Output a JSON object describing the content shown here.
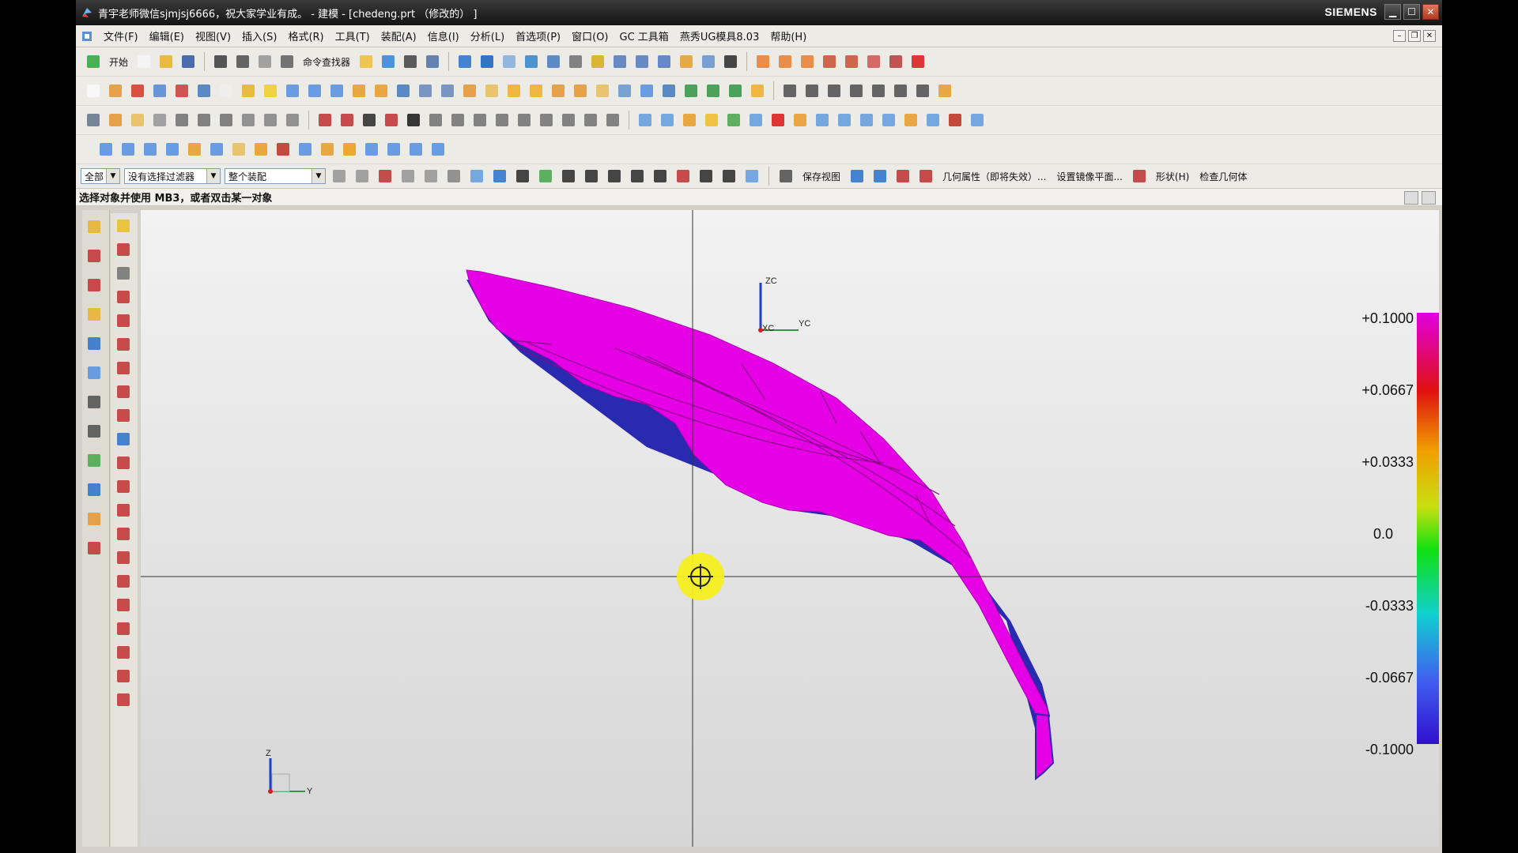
{
  "window": {
    "title": "青宇老师微信sjmjsj6666，祝大家学业有成。 - 建模 - [chedeng.prt （修改的） ]",
    "brand": "SIEMENS",
    "controls": {
      "minimize": "▁",
      "maximize": "☐",
      "close": "✕"
    }
  },
  "menubar": {
    "items": [
      "文件(F)",
      "编辑(E)",
      "视图(V)",
      "插入(S)",
      "格式(R)",
      "工具(T)",
      "装配(A)",
      "信息(I)",
      "分析(L)",
      "首选项(P)",
      "窗口(O)",
      "GC 工具箱",
      "燕秀UG模具8.03",
      "帮助(H)"
    ],
    "mdi_controls": {
      "minimize": "–",
      "restore": "❐",
      "close": "✕"
    }
  },
  "toolbar": {
    "start_label": "开始",
    "command_finder_label": "命令查找器"
  },
  "selection_bar": {
    "filter_scope": "全部",
    "type_filter": "没有选择过滤器",
    "assembly_scope": "整个装配",
    "save_view_label": "保存视图",
    "geom_props_label": "几何属性（即将失效）...",
    "mirror_plane_label": "设置镜像平面...",
    "shape_label": "形状(H)",
    "check_geom_label": "检查几何体"
  },
  "cue_line": {
    "text": "选择对象并使用 MB3，或者双击某一对象"
  },
  "viewport": {
    "wcs_labels": {
      "z": "ZC",
      "y": "YC",
      "x": "XC"
    },
    "abs_csys_labels": {
      "z": "Z",
      "y": "Y"
    },
    "legend": {
      "ticks": [
        "+0.1000",
        "+0.0667",
        "+0.0333",
        "0.0",
        "-0.0333",
        "-0.0667",
        "-0.1000"
      ]
    },
    "colors": {
      "part": "#e600e6",
      "part_shadow": "#2a2ab0",
      "cursor_highlight": "#f4ef1e"
    }
  }
}
